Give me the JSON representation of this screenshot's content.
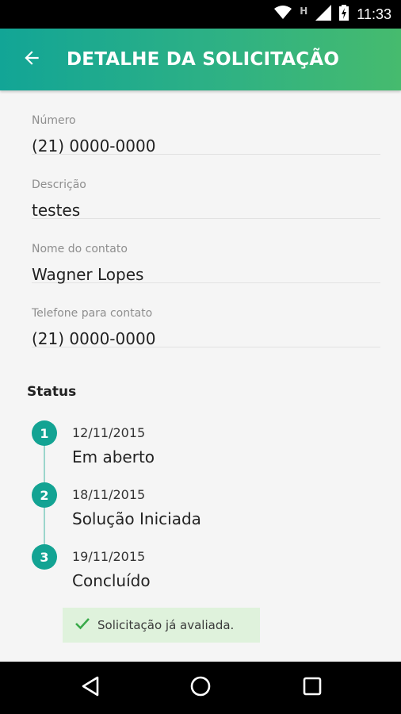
{
  "status_bar": {
    "time": "11:33",
    "icons": [
      "wifi-icon",
      "h-network-icon",
      "signal-icon",
      "battery-charging-icon"
    ],
    "network_label": "H"
  },
  "app_bar": {
    "title": "DETALHE DA SOLICITAÇÃO",
    "back_icon": "arrow-back-icon",
    "gradient": [
      "#12a596",
      "#46bb6e"
    ]
  },
  "fields": [
    {
      "label": "Número",
      "value": "(21) 0000-0000"
    },
    {
      "label": "Descrição",
      "value": "testes"
    },
    {
      "label": "Nome do contato",
      "value": "Wagner Lopes"
    },
    {
      "label": "Telefone para contato",
      "value": "(21) 0000-0000"
    }
  ],
  "status": {
    "title": "Status",
    "steps": [
      {
        "number": "1",
        "date": "12/11/2015",
        "description": "Em aberto"
      },
      {
        "number": "2",
        "date": "18/11/2015",
        "description": "Solução Iniciada"
      },
      {
        "number": "3",
        "date": "19/11/2015",
        "description": "Concluído"
      }
    ],
    "accent_color": "#13a393"
  },
  "evaluation_notice": {
    "icon": "check-icon",
    "text": "Solicitação já avaliada.",
    "background": "#dff2dc"
  },
  "nav_bar": {
    "buttons": [
      "nav-back-icon",
      "nav-home-icon",
      "nav-recent-icon"
    ]
  }
}
